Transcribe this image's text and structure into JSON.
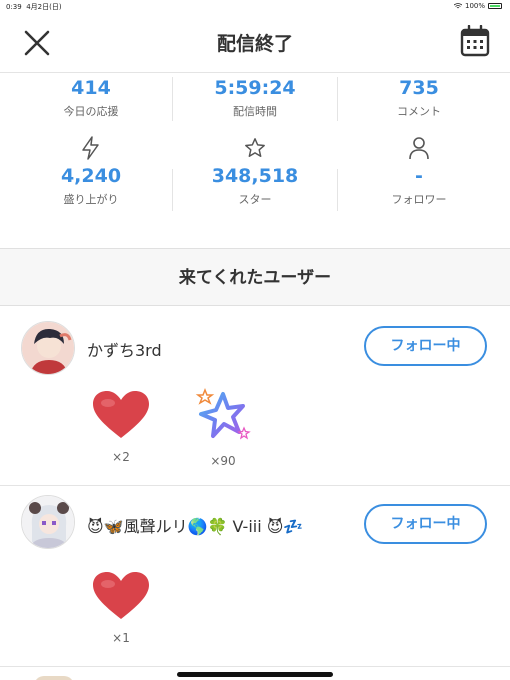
{
  "status_bar": {
    "time": "0:39",
    "date": "4月2日(日)",
    "battery": "100%"
  },
  "header": {
    "title": "配信終了",
    "close_icon": "close-icon",
    "calendar_icon": "calendar-icon"
  },
  "stats": [
    {
      "value": "414",
      "label": "今日の応援"
    },
    {
      "value": "5:59:24",
      "label": "配信時間"
    },
    {
      "value": "735",
      "label": "コメント"
    },
    {
      "icon": "lightning-icon",
      "value": "4,240",
      "label": "盛り上がり"
    },
    {
      "icon": "star-icon",
      "value": "348,518",
      "label": "スター"
    },
    {
      "icon": "person-icon",
      "value": "-",
      "label": "フォロワー"
    }
  ],
  "section_title": "来てくれたユーザー",
  "users": [
    {
      "name": "かずち3rd",
      "follow_label": "フォロー中",
      "gifts": [
        {
          "icon": "heart-icon",
          "count": "×2"
        },
        {
          "icon": "star-gift-icon",
          "count": "×90"
        }
      ]
    },
    {
      "name": "😈🦋風聲ルリ🌎🍀 V-iii 😈💤",
      "follow_label": "フォロー中",
      "gifts": [
        {
          "icon": "heart-icon",
          "count": "×1"
        }
      ]
    }
  ],
  "colors": {
    "accent": "#3a8ee0",
    "heart": "#d9434a"
  }
}
